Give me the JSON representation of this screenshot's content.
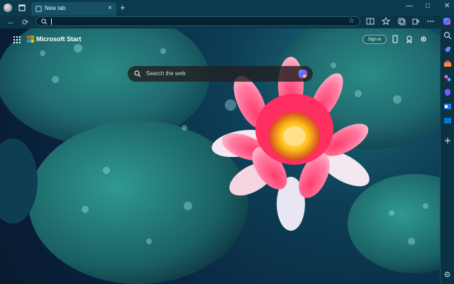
{
  "browser": {
    "tab_title": "New tab",
    "tab_close": "×",
    "new_tab": "+",
    "window": {
      "minimize": "—",
      "maximize": "□",
      "close": "✕"
    },
    "nav": {
      "back": "←",
      "refresh": "⟳"
    },
    "address": {
      "value": "",
      "placeholder": ""
    },
    "favorite_icon": "☆"
  },
  "page": {
    "brand": "Microsoft Start",
    "sign_in": "Sign in",
    "search_placeholder": "Search the web"
  },
  "colors": {
    "titlebar": "#0c3a4e",
    "toolbar": "#0b3446",
    "accent": "#f2a3b8"
  },
  "icons": {
    "toolbar": [
      "split-screen-icon",
      "favorites-icon",
      "collections-icon",
      "extensions-icon",
      "more-icon",
      "copilot-icon"
    ],
    "sidebar": [
      "search-icon",
      "tag-icon",
      "briefcase-icon",
      "games-icon",
      "shield-icon",
      "outlook-icon",
      "plus-icon",
      "settings-icon"
    ],
    "page_right": [
      "phone-icon",
      "rewards-icon",
      "gear-icon"
    ]
  }
}
